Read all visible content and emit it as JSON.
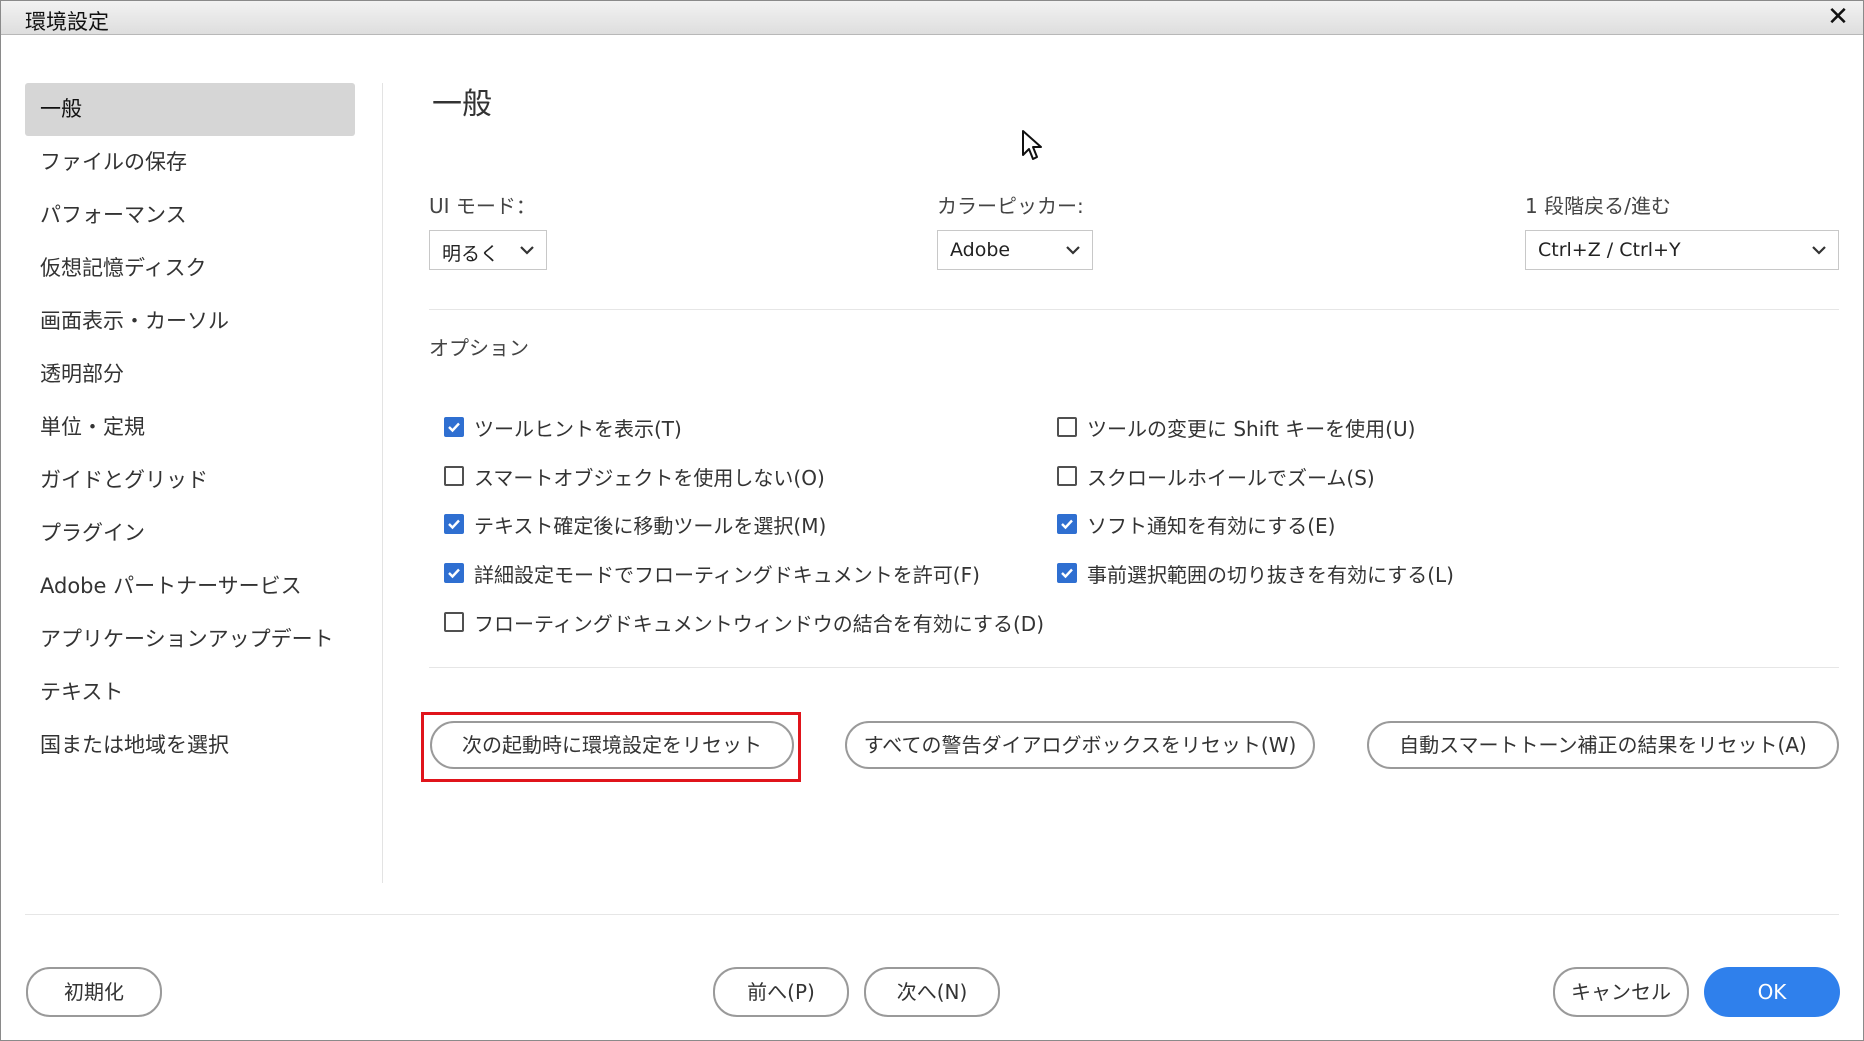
{
  "window": {
    "title": "環境設定",
    "close_glyph": "✕"
  },
  "sidebar": {
    "items": [
      {
        "label": "一般",
        "active": true
      },
      {
        "label": "ファイルの保存"
      },
      {
        "label": "パフォーマンス"
      },
      {
        "label": "仮想記憶ディスク"
      },
      {
        "label": "画面表示・カーソル"
      },
      {
        "label": "透明部分"
      },
      {
        "label": "単位・定規"
      },
      {
        "label": "ガイドとグリッド"
      },
      {
        "label": "プラグイン"
      },
      {
        "label": "Adobe パートナーサービス"
      },
      {
        "label": "アプリケーションアップデート"
      },
      {
        "label": "テキスト"
      },
      {
        "label": "国または地域を選択"
      }
    ]
  },
  "main": {
    "title": "一般",
    "ui_mode": {
      "label": "UI モード：",
      "value": "明るく"
    },
    "color_picker": {
      "label": "カラーピッカー:",
      "value": "Adobe"
    },
    "undo": {
      "label": "1 段階戻る/進む",
      "value": "Ctrl+Z / Ctrl+Y"
    },
    "options_label": "オプション",
    "options_left": [
      {
        "label": "ツールヒントを表示(T)",
        "checked": true
      },
      {
        "label": "スマートオブジェクトを使用しない(O)",
        "checked": false
      },
      {
        "label": "テキスト確定後に移動ツールを選択(M)",
        "checked": true
      },
      {
        "label": "詳細設定モードでフローティングドキュメントを許可(F)",
        "checked": true
      },
      {
        "label": "フローティングドキュメントウィンドウの結合を有効にする(D)",
        "checked": false
      }
    ],
    "options_right": [
      {
        "label": "ツールの変更に Shift キーを使用(U)",
        "checked": false
      },
      {
        "label": "スクロールホイールでズーム(S)",
        "checked": false
      },
      {
        "label": "ソフト通知を有効にする(E)",
        "checked": true
      },
      {
        "label": "事前選択範囲の切り抜きを有効にする(L)",
        "checked": true
      }
    ],
    "reset_buttons": {
      "prefs": "次の起動時に環境設定をリセット",
      "warnings": "すべての警告ダイアログボックスをリセット(W)",
      "auto_tone": "自動スマートトーン補正の結果をリセット(A)"
    }
  },
  "footer": {
    "reset": "初期化",
    "prev": "前へ(P)",
    "next": "次へ(N)",
    "cancel": "キャンセル",
    "ok": "OK"
  },
  "colors": {
    "accent": "#2f80ec",
    "checkbox": "#2f6fd1",
    "highlight": "#e0141b"
  },
  "icons": [
    "close-icon",
    "chevron-down-icon",
    "check-icon",
    "mouse-pointer-icon"
  ]
}
